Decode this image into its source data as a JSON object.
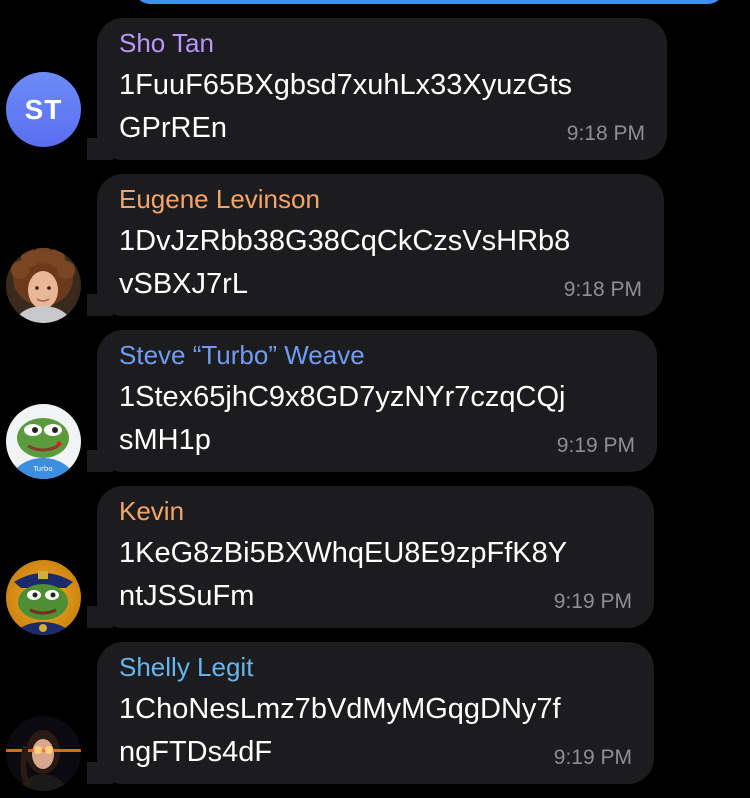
{
  "messages": [
    {
      "sender": "Sho Tan",
      "sender_color": "#b895ff",
      "text_line1": "1FuuF65BXgbsd7xuhLx33XyuzGts",
      "text_line2": "GPrREn",
      "time": "9:18 PM",
      "avatar": {
        "type": "initials",
        "initials": "ST"
      }
    },
    {
      "sender": "Eugene Levinson",
      "sender_color": "#f5a56a",
      "text_line1": "1DvJzRbb38G38CqCkCzsVsHRb8",
      "text_line2": "vSBXJ7rL",
      "time": "9:18 PM",
      "avatar": {
        "type": "photo",
        "icon": "curly-hair-person-avatar"
      }
    },
    {
      "sender": "Steve “Turbo” Weave",
      "sender_color": "#6e9cf7",
      "text_line1": "1Stex65jhC9x8GD7yzNYr7czqCQj",
      "text_line2": "sMH1p",
      "time": "9:19 PM",
      "avatar": {
        "type": "photo",
        "icon": "pepe-frog-avatar"
      }
    },
    {
      "sender": "Kevin",
      "sender_color": "#f5a56a",
      "text_line1": "1KeG8zBi5BXWhqEU8E9zpFfK8Y",
      "text_line2": "ntJSSuFm",
      "time": "9:19 PM",
      "avatar": {
        "type": "photo",
        "icon": "pepe-cop-avatar"
      }
    },
    {
      "sender": "Shelly Legit",
      "sender_color": "#64b6ee",
      "text_line1": "1ChoNesLmz7bVdMyMGqgDNy7f",
      "text_line2": "ngFTDs4dF",
      "time": "9:19 PM",
      "avatar": {
        "type": "photo",
        "icon": "woman-laser-eyes-avatar"
      }
    }
  ]
}
